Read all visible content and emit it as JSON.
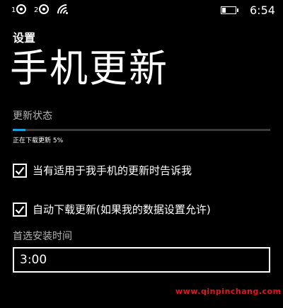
{
  "status_bar": {
    "icons": [
      "signal-icon",
      "signal-icon",
      "wifi-icon",
      "battery-icon"
    ],
    "time": "6:54",
    "battery_level": 0.3
  },
  "header": {
    "section": "设置",
    "title": "手机更新"
  },
  "update_status": {
    "label": "更新状态",
    "progress_text": "正在下载更新 5%",
    "progress": 0.05,
    "accent_color": "#1ba1e2"
  },
  "options": [
    {
      "label": "当有适用于我手机的更新时告诉我",
      "checked": true
    },
    {
      "label": "自动下载更新(如果我的数据设置允许)",
      "checked": true
    }
  ],
  "install_time": {
    "label": "首选安装时间",
    "value": "3:00"
  },
  "watermark": "www.qinpinchang.com"
}
